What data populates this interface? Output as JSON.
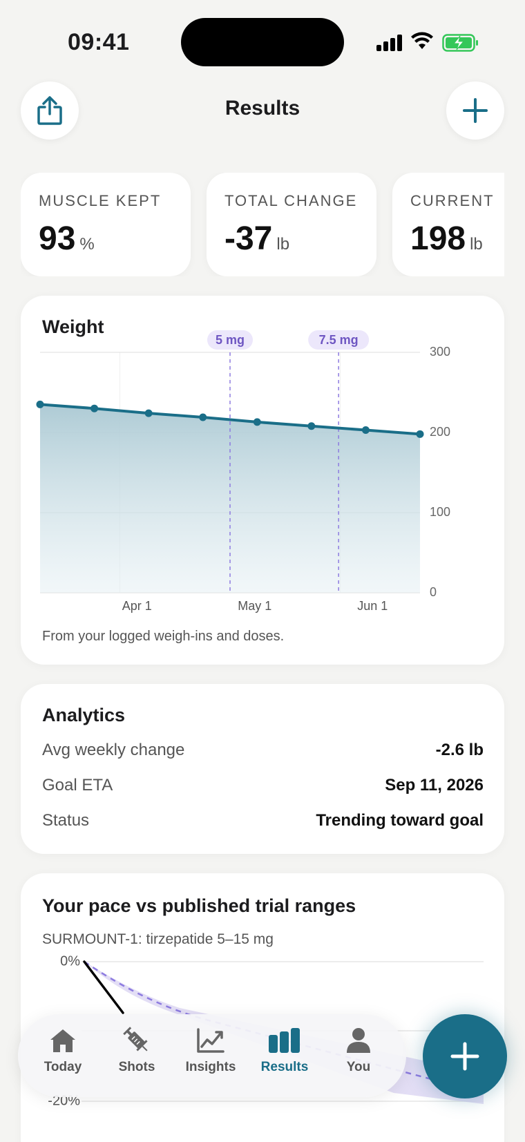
{
  "status_bar": {
    "time": "09:41"
  },
  "header": {
    "title": "Results"
  },
  "stats": [
    {
      "label": "MUSCLE KEPT",
      "value": "93",
      "unit": "%"
    },
    {
      "label": "TOTAL CHANGE",
      "value": "-37",
      "unit": "lb"
    },
    {
      "label": "CURRENT",
      "value": "198",
      "unit": "lb"
    }
  ],
  "weight_card": {
    "title": "Weight",
    "note": "From your logged weigh-ins and doses.",
    "dose_markers": [
      "5 mg",
      "7.5 mg"
    ]
  },
  "analytics": {
    "title": "Analytics",
    "rows": [
      {
        "label": "Avg weekly change",
        "value": "-2.6 lb"
      },
      {
        "label": "Goal ETA",
        "value": "Sep 11, 2026"
      },
      {
        "label": "Status",
        "value": "Trending toward goal"
      }
    ]
  },
  "pace": {
    "title": "Your pace vs published trial ranges",
    "subtitle": "SURMOUNT-1: tirzepatide 5–15 mg",
    "y_ticks": [
      "0%",
      "-20%"
    ]
  },
  "tabs": [
    {
      "label": "Today",
      "icon": "house-icon"
    },
    {
      "label": "Shots",
      "icon": "syringe-icon"
    },
    {
      "label": "Insights",
      "icon": "trend-chart-icon"
    },
    {
      "label": "Results",
      "icon": "bar-chart-icon",
      "active": true
    },
    {
      "label": "You",
      "icon": "person-icon"
    }
  ],
  "colors": {
    "accent": "#1a6e88",
    "dose_marker": "#7b5cc6",
    "background": "#f4f4f2"
  },
  "chart_data": {
    "type": "area",
    "title": "Weight",
    "y_ticks": [
      0,
      100,
      200,
      300
    ],
    "ylim": [
      0,
      300
    ],
    "x_tick_labels": [
      "Apr 1",
      "May 1",
      "Jun 1"
    ],
    "points": [
      235,
      230,
      224,
      219,
      213,
      208,
      203,
      198
    ],
    "dose_markers": [
      {
        "label": "5 mg",
        "at_point": 3.5
      },
      {
        "label": "7.5 mg",
        "at_point": 5.5
      }
    ],
    "grid": true
  }
}
